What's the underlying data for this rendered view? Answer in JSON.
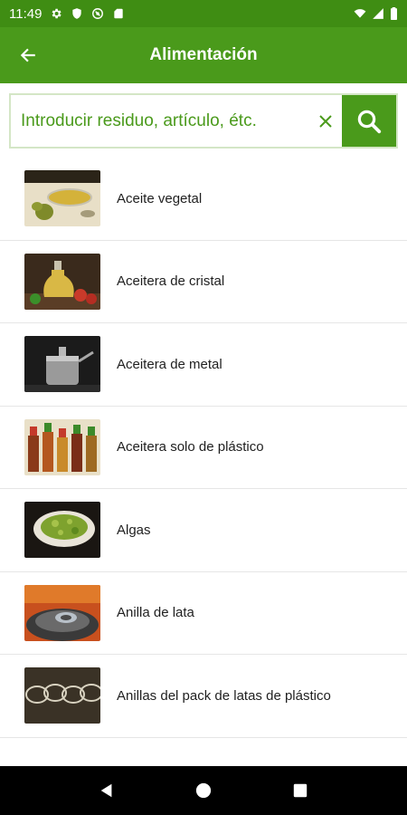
{
  "status_bar": {
    "time": "11:49",
    "left_icons": [
      "gear-icon",
      "shield-icon",
      "vpn-icon",
      "sd-card-icon"
    ],
    "right_icons": [
      "wifi-icon",
      "signal-icon",
      "battery-icon"
    ]
  },
  "app_bar": {
    "title": "Alimentación",
    "back_icon": "arrow-back-icon"
  },
  "search": {
    "placeholder": "Introducir residuo, artículo, étc.",
    "value": "",
    "clear_icon": "close-icon",
    "search_icon": "search-icon"
  },
  "colors": {
    "primary": "#4a9a1b",
    "status_bar": "#3f8d13",
    "divider": "#e6e6e6",
    "text": "#1f1f1f"
  },
  "items": [
    {
      "label": "Aceite vegetal",
      "image": "vegetable-oil-thumbnail"
    },
    {
      "label": "Aceitera de cristal",
      "image": "glass-oil-cruet-thumbnail"
    },
    {
      "label": "Aceitera de metal",
      "image": "metal-oil-can-thumbnail"
    },
    {
      "label": "Aceitera solo de plástico",
      "image": "plastic-oil-bottles-thumbnail"
    },
    {
      "label": "Algas",
      "image": "seaweed-thumbnail"
    },
    {
      "label": "Anilla de lata",
      "image": "can-ring-thumbnail"
    },
    {
      "label": "Anillas del pack de latas de plástico",
      "image": "plastic-six-pack-rings-thumbnail"
    }
  ],
  "nav_bar": {
    "icons": [
      "back-triangle-icon",
      "home-circle-icon",
      "recents-square-icon"
    ]
  }
}
